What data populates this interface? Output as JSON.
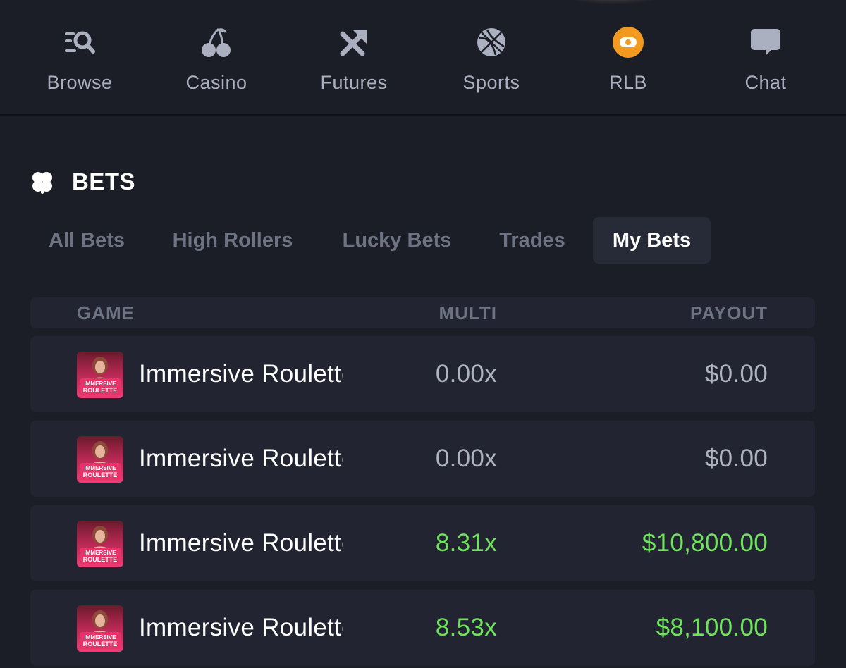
{
  "nav": {
    "items": [
      {
        "label": "Browse",
        "icon": "browse-search-icon"
      },
      {
        "label": "Casino",
        "icon": "cherries-icon"
      },
      {
        "label": "Futures",
        "icon": "arrows-up-icon"
      },
      {
        "label": "Sports",
        "icon": "basketball-icon"
      },
      {
        "label": "RLB",
        "icon": "rlb-token-icon"
      },
      {
        "label": "Chat",
        "icon": "chat-bubble-icon"
      }
    ]
  },
  "section": {
    "title": "BETS",
    "icon": "clover-icon"
  },
  "tabs": [
    {
      "label": "All Bets"
    },
    {
      "label": "High Rollers"
    },
    {
      "label": "Lucky Bets"
    },
    {
      "label": "Trades"
    },
    {
      "label": "My Bets",
      "active": true
    }
  ],
  "table": {
    "headers": {
      "game": "GAME",
      "multi": "MULTI",
      "payout": "PAYOUT"
    },
    "rows": [
      {
        "game": "Immersive Roulette",
        "thumb_text": "IMMERSIVE ROULETTE",
        "multi": "0.00x",
        "payout": "$0.00",
        "status": "neutral"
      },
      {
        "game": "Immersive Roulette",
        "thumb_text": "IMMERSIVE ROULETTE",
        "multi": "0.00x",
        "payout": "$0.00",
        "status": "neutral"
      },
      {
        "game": "Immersive Roulette",
        "thumb_text": "IMMERSIVE ROULETTE",
        "multi": "8.31x",
        "payout": "$10,800.00",
        "status": "win"
      },
      {
        "game": "Immersive Roulette",
        "thumb_text": "IMMERSIVE ROULETTE",
        "multi": "8.53x",
        "payout": "$8,100.00",
        "status": "win"
      }
    ]
  },
  "colors": {
    "background": "#1b1d27",
    "row": "#222531",
    "win": "#6fe35c",
    "neutral": "#aeb3c0",
    "rlb_accent": "#f29a1f"
  }
}
